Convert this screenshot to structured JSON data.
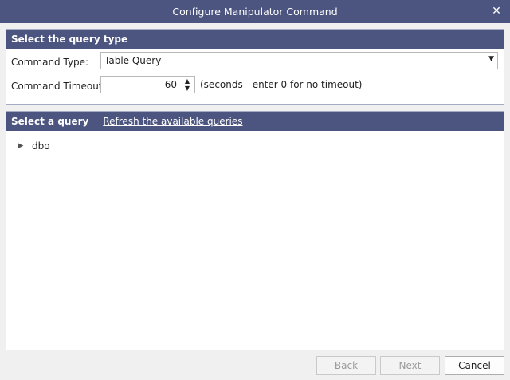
{
  "window": {
    "title": "Configure Manipulator Command",
    "close_glyph": "✕"
  },
  "query_type": {
    "header": "Select the query type",
    "command_type_label": "Command Type:",
    "command_type_value": "Table Query",
    "command_timeout_label": "Command Timeout:",
    "command_timeout_value": "60",
    "timeout_hint": "(seconds - enter 0 for no timeout)"
  },
  "query_select": {
    "header": "Select a query",
    "refresh_link": "Refresh the available queries",
    "tree": [
      {
        "label": "dbo",
        "expanded": false
      }
    ]
  },
  "footer": {
    "back_label": "Back",
    "next_label": "Next",
    "cancel_label": "Cancel"
  },
  "colors": {
    "header_bg": "#4c5480",
    "window_bg": "#f0f0f0"
  }
}
